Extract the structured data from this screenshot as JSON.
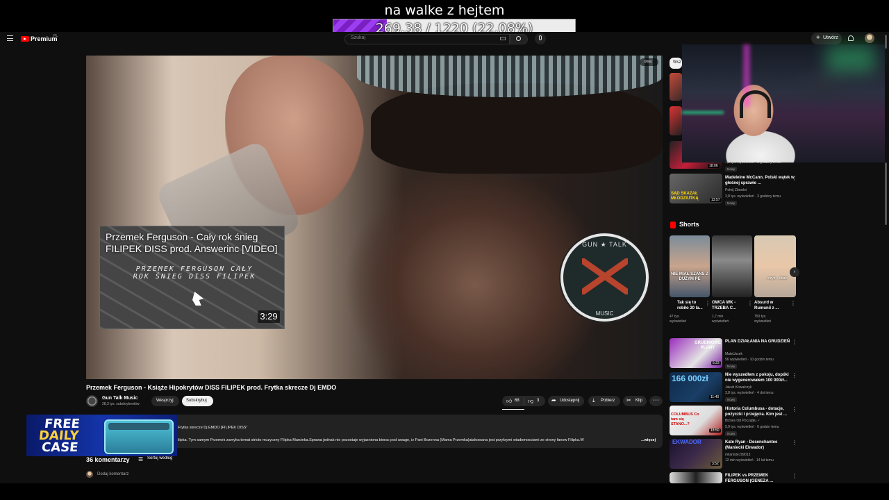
{
  "overlay": {
    "goal_title": "na walke z hejtem",
    "goal_text": "269.38 / 1220 (22.08%)",
    "goal_progress": 0.2208,
    "goal_fill_color": "#8a2be2"
  },
  "header": {
    "logo_text": "Premium",
    "logo_country": "PL",
    "search_placeholder": "Szukaj",
    "create_plus": "+",
    "create_label": "Utwórz"
  },
  "player": {
    "hide_label": "Ukryj",
    "end_card": {
      "title": "Przemek Ferguson - Cały rok śnieg FILIPEK DISS prod. Answerinc [VIDEO]",
      "art_text": "PRZEMEK FERGUSON CAŁY ROK ŚNIEG DISS FILIPEK",
      "duration": "3:29"
    },
    "badge": {
      "top": "GUN ★ TALK",
      "bottom": "MUSIC"
    }
  },
  "video": {
    "title": "Przemek Ferguson - Książe Hipokrytów DISS FILIPEK prod. Frytka skrecze Dj EMDO",
    "channel": "Gun Talk Music",
    "subscribers": "28,3 tys. subskrybentów",
    "support_label": "Wesprzyj",
    "subscribe_label": "Subskrybuj",
    "likes": "68",
    "dislikes": "3",
    "share_label": "Udostępnij",
    "download_label": "Pobierz",
    "clip_label": "Klip",
    "more_icon": "⋯"
  },
  "description": {
    "line1": "Frytka skrecze Dj EMDO [FILIPEK DISS\"",
    "line2": "ilipka. Tym samym Przemek zamyka temat stricto muzyczny Filipka Marcinka.Sprawa jednak nie pozostaje wyjasniona biorac pod uwage, iz Pani Bozenna (Mama Przemka)atakowana jest przykrymi wiadomosciami ze strony fanow Filipka.W",
    "more": "...więcej"
  },
  "comments": {
    "count": "36 komentarzy",
    "sort_label": "Sortuj według",
    "add_placeholder": "Dodaj komentarz"
  },
  "case_banner": {
    "free": "FREE",
    "daily": "DAILY",
    "case": "CASE"
  },
  "sidebar": {
    "chip": "Wsz",
    "items_top": [
      {
        "duration": "18:06",
        "meta": "9,1 tys. wyświetleń · 3 godziny temu",
        "badge": "Nowy"
      },
      {
        "title": "Madeleine McCann. Polski wątek w głośnej sprawie ...",
        "channel": "Pokój Zbrodni",
        "meta": "3,8 tys. wyświetleń · 3 godziny temu",
        "badge": "Nowy",
        "duration": "13:57",
        "thumb_text": "SĄD SKAZAŁ MŁODZIUTKĄ"
      }
    ],
    "shorts_label": "Shorts",
    "shorts": [
      {
        "title": "Tak się to robiło 20 la...",
        "meta": "47 tys. wyświetleń",
        "thumb_text": "NIE MIAŁ SZANS Z DUŻYM PE"
      },
      {
        "title": "OWCA WK - TRZEBA C...",
        "meta": "1,7 mln wyświetleń",
        "thumb_text": ""
      },
      {
        "title": "Absurd w Rumunii z ...",
        "meta": "750 tys. wyświetleń",
        "thumb_text": "...czyn... obaw"
      }
    ],
    "items": [
      {
        "title": "PLAN DZIAŁANIA NA GRUDZIEŃ",
        "channel": "MateUszek",
        "meta": "56 wyświetleń · 10 godzin temu",
        "badge": "Nowy",
        "duration": "5:22",
        "thumb_text": "GRUDNIOWE PLANY"
      },
      {
        "title": "Nie wyszedłem z pokoju, dopóki nie wygenerowałem 100 000zł...",
        "channel": "Jakub Kowalczyk",
        "meta": "3,8 tys. wyświetleń · 4 dni temu",
        "badge": "Nowy",
        "duration": "11:40",
        "thumb_text": "166 000zł"
      },
      {
        "title": "Historia Columbusa - dotacje, pożyczki i przejęcia. Kim jest ...",
        "channel": "Biznes Od Początku ✓",
        "meta": "5,9 tys. wyświetleń · 6 godzin temu",
        "badge": "Nowy",
        "duration": "18:50",
        "thumb_text": "COLUMBUS Co tam się STANO...?"
      },
      {
        "title": "Kate Ryan - Desenchantee (Maniecki Ekwador)",
        "channel": "milaniste199013",
        "meta": "12 mln wyświetleń · 14 lat temu",
        "badge": "",
        "duration": "3:52",
        "thumb_text": "EKWADOR"
      },
      {
        "title": "FILIPEK vs PRZEMEK FERGUSON (GENEZA ...",
        "channel": "",
        "meta": "",
        "badge": "",
        "duration": "",
        "thumb_text": ""
      }
    ]
  }
}
